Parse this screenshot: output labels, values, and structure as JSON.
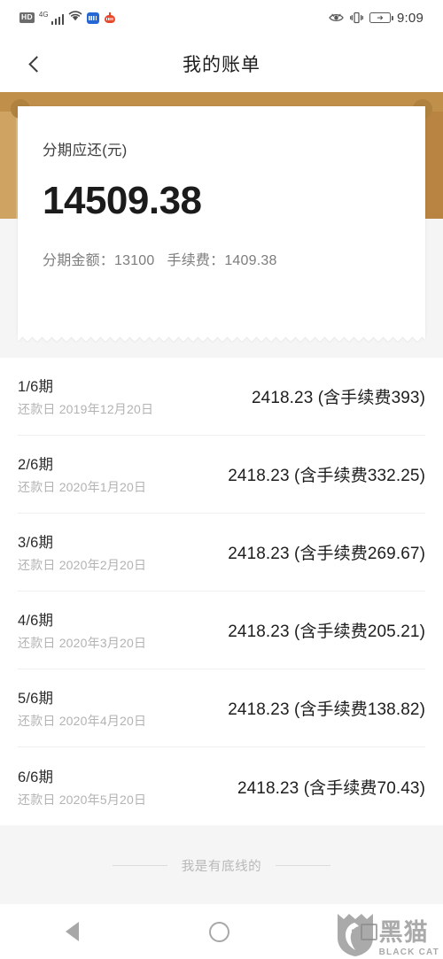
{
  "statusbar": {
    "hd_label": "HD",
    "network_label": "4G",
    "signal_icon": "signal-bars-icon",
    "wifi_icon": "wifi-icon",
    "app1_icon": "blue-app-icon",
    "app2_icon": "red-app-icon",
    "eye_icon": "eye-icon",
    "vibrate_icon": "vibrate-icon",
    "battery_icon": "battery-charging-icon",
    "time": "9:09"
  },
  "header": {
    "back_icon": "chevron-left-icon",
    "title": "我的账单"
  },
  "summary": {
    "label": "分期应还(元)",
    "amount": "14509.38",
    "principal_label": "分期金额：",
    "principal_value": "13100",
    "fee_label": "手续费：",
    "fee_value": "1409.38"
  },
  "installments": [
    {
      "term": "1/6期",
      "date": "还款日 2019年12月20日",
      "amount": "2418.23 (含手续费393)"
    },
    {
      "term": "2/6期",
      "date": "还款日 2020年1月20日",
      "amount": "2418.23 (含手续费332.25)"
    },
    {
      "term": "3/6期",
      "date": "还款日 2020年2月20日",
      "amount": "2418.23 (含手续费269.67)"
    },
    {
      "term": "4/6期",
      "date": "还款日 2020年3月20日",
      "amount": "2418.23 (含手续费205.21)"
    },
    {
      "term": "5/6期",
      "date": "还款日 2020年4月20日",
      "amount": "2418.23 (含手续费138.82)"
    },
    {
      "term": "6/6期",
      "date": "还款日 2020年5月20日",
      "amount": "2418.23 (含手续费70.43)"
    }
  ],
  "footer": {
    "end_text": "我是有底线的"
  },
  "navbar": {
    "back_icon": "nav-back-triangle-icon",
    "home_icon": "nav-home-circle-icon",
    "recent_icon": "nav-recent-square-icon"
  },
  "watermark": {
    "logo_icon": "black-cat-shield-logo",
    "cn_text": "黑猫",
    "en_text": "BLACK CAT"
  },
  "colors": {
    "gold_dark": "#c08f4a",
    "gold_light": "#dfb97f",
    "gold_right": "#b98442",
    "page_bg": "#f5f5f5",
    "card_bg": "#ffffff",
    "amount_text": "#1b1b1b",
    "muted_text": "#b3b3b3"
  }
}
